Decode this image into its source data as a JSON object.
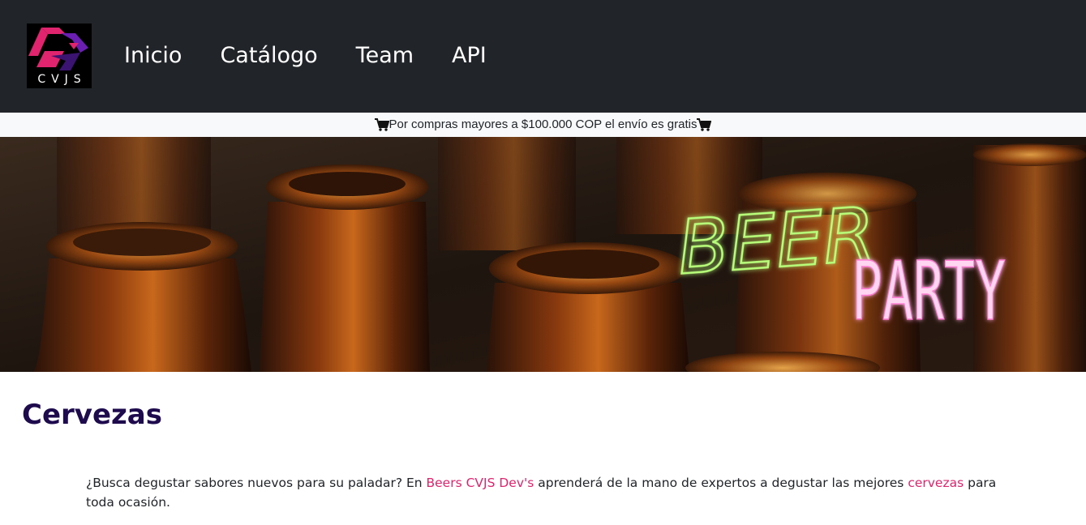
{
  "brand": {
    "logo_text": "CVJS"
  },
  "nav": {
    "items": [
      {
        "label": "Inicio"
      },
      {
        "label": "Catálogo"
      },
      {
        "label": "Team"
      },
      {
        "label": "API"
      }
    ]
  },
  "promo": {
    "text": "Por compras mayores a $100.000 COP el envío es gratis"
  },
  "banner": {
    "line1": "BEER",
    "line2": "PARTY"
  },
  "content": {
    "title": "Cervezas",
    "intro_part1": "¿Busca degustar sabores nuevos para su paladar? En ",
    "intro_link1": "Beers CVJS Dev's",
    "intro_part2": " aprenderá de la mano de expertos a degustar las mejores ",
    "intro_link2": "cervezas",
    "intro_part3": " para toda ocasión."
  },
  "colors": {
    "navbar": "#212529",
    "accent_pink": "#e0246e",
    "title": "#1d0b4d",
    "neon_green": "#b8ff7a",
    "neon_pink": "#ff7ad2"
  },
  "icons": [
    "cart-icon",
    "logo-icon"
  ]
}
